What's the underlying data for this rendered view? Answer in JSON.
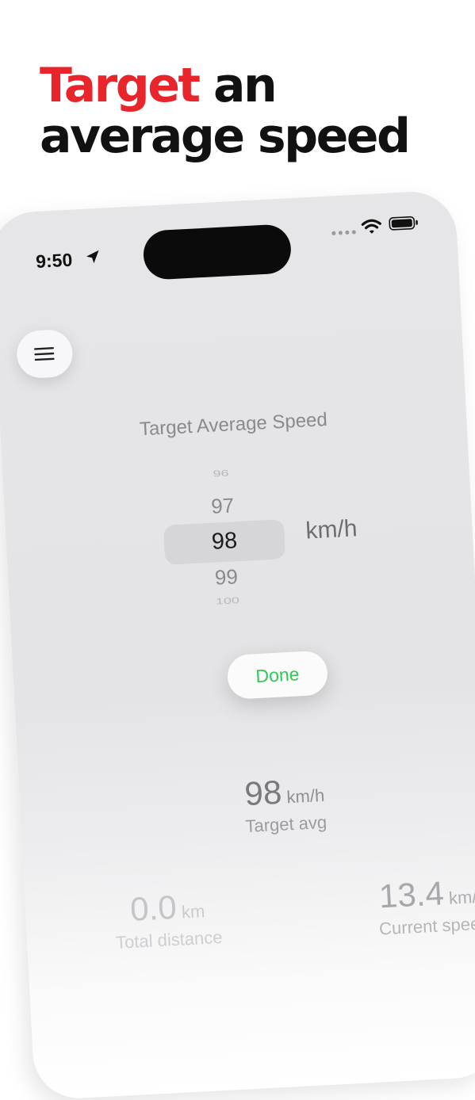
{
  "headline": {
    "accent": "Target",
    "line1_rest": " an",
    "line2": "average speed"
  },
  "status_bar": {
    "time": "9:50",
    "icons": [
      "location-arrow-icon",
      "cellular-signal-icon",
      "wifi-icon",
      "battery-icon"
    ]
  },
  "menu": {
    "icon": "hamburger-menu-icon"
  },
  "picker": {
    "title": "Target Average Speed",
    "values": [
      "96",
      "97",
      "98",
      "99",
      "100"
    ],
    "selected": "98",
    "unit": "km/h"
  },
  "done_label": "Done",
  "stats": {
    "target": {
      "value": "98",
      "unit": "km/h",
      "label": "Target avg"
    },
    "distance": {
      "value": "0.0",
      "unit": "km",
      "label": "Total distance"
    },
    "speed": {
      "value": "13.4",
      "unit": "km/h",
      "label": "Current speed"
    }
  },
  "colors": {
    "accent_red": "#e8252b",
    "done_green": "#34c759"
  }
}
